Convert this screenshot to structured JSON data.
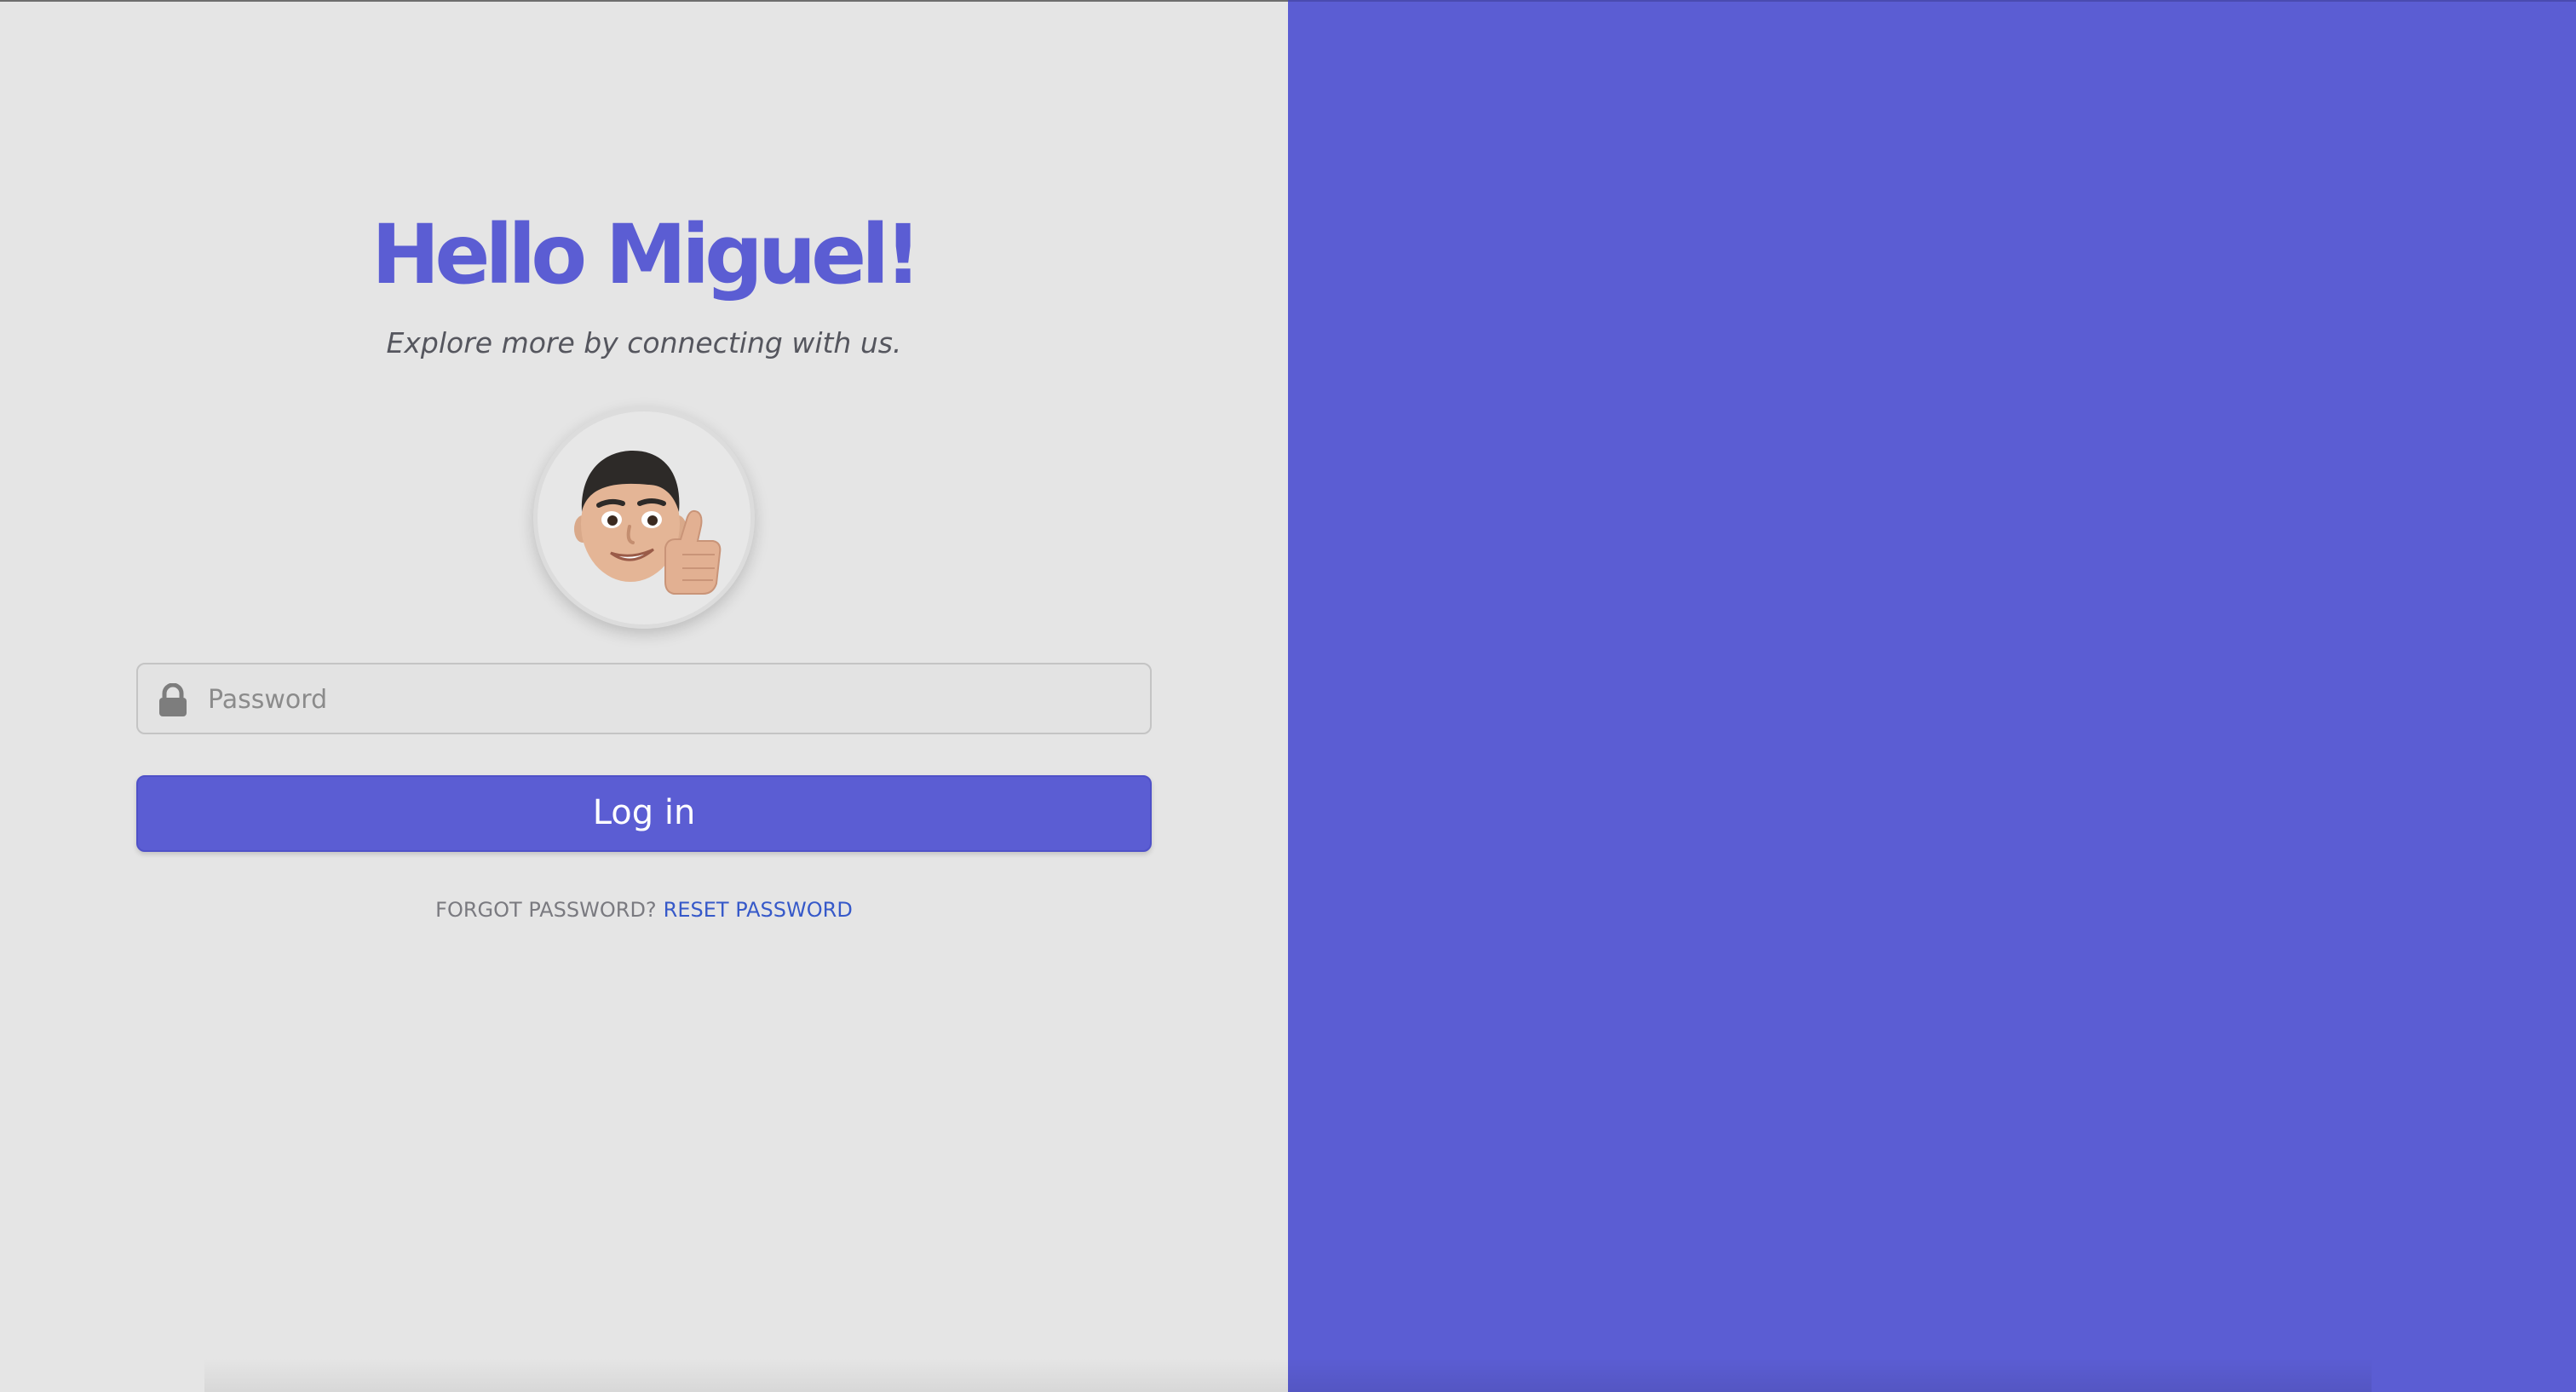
{
  "greeting": {
    "title": "Hello Miguel!",
    "subtitle": "Explore more by connecting with us."
  },
  "avatar": {
    "icon": "memoji-thumbs-up-icon"
  },
  "password": {
    "placeholder": "Password",
    "value": "",
    "icon": "lock-icon"
  },
  "login": {
    "label": "Log in"
  },
  "forgot": {
    "prompt": "FORGOT PASSWORD?",
    "link_label": "RESET PASSWORD"
  },
  "colors": {
    "accent": "#5b5dd3",
    "left_background": "#e5e5e5",
    "link": "#3659c9"
  }
}
